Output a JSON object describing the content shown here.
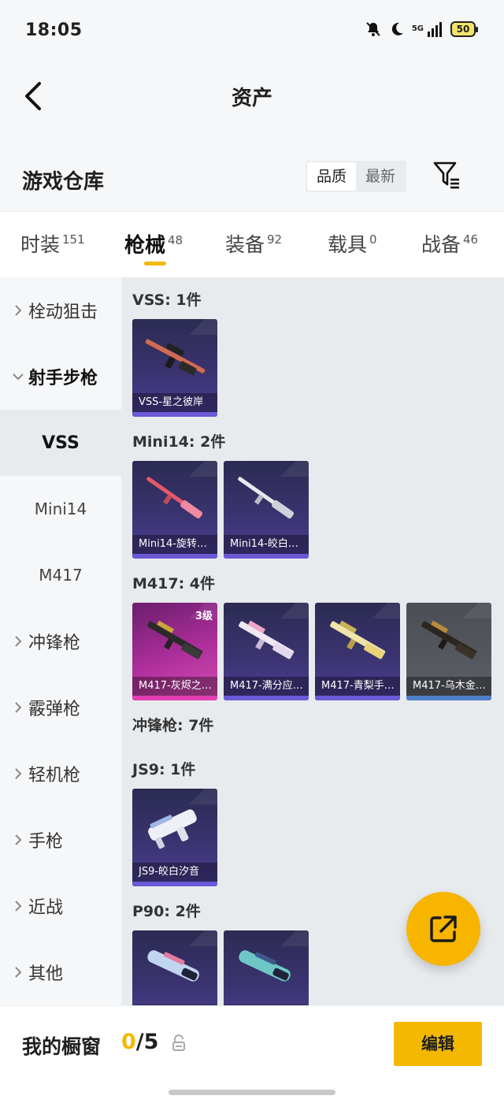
{
  "status_bar": {
    "time": "18:05",
    "network": "5G",
    "battery": "50"
  },
  "nav": {
    "title": "资产"
  },
  "warehouse": {
    "title": "游戏仓库",
    "sort_options": [
      "品质",
      "最新"
    ],
    "sort_selected": "品质"
  },
  "tabs": [
    {
      "label": "时装",
      "count": "151",
      "active": false
    },
    {
      "label": "枪械",
      "count": "48",
      "active": true
    },
    {
      "label": "装备",
      "count": "92",
      "active": false
    },
    {
      "label": "载具",
      "count": "0",
      "active": false
    },
    {
      "label": "战备",
      "count": "46",
      "active": false
    }
  ],
  "sidebar": {
    "categories": [
      {
        "label": "栓动狙击",
        "expanded": false
      },
      {
        "label": "射手步枪",
        "expanded": true
      },
      {
        "label": "冲锋枪",
        "expanded": false
      },
      {
        "label": "霰弹枪",
        "expanded": false
      },
      {
        "label": "轻机枪",
        "expanded": false
      },
      {
        "label": "手枪",
        "expanded": false
      },
      {
        "label": "近战",
        "expanded": false
      },
      {
        "label": "其他",
        "expanded": false
      }
    ],
    "subitems": [
      {
        "label": "VSS",
        "selected": true
      },
      {
        "label": "Mini14",
        "selected": false
      },
      {
        "label": "M417",
        "selected": false
      }
    ]
  },
  "groups": [
    {
      "title": "VSS: 1件",
      "items": [
        {
          "label": "VSS-星之彼岸",
          "rarity": "epic"
        }
      ]
    },
    {
      "title": "Mini14: 2件",
      "items": [
        {
          "label": "Mini14-旋转…",
          "rarity": "epic"
        },
        {
          "label": "Mini14-皎白…",
          "rarity": "epic"
        }
      ]
    },
    {
      "title": "M417: 4件",
      "items": [
        {
          "label": "M417-灰烬之…",
          "rarity": "legendary",
          "level": "3级"
        },
        {
          "label": "M417-满分应…",
          "rarity": "epic"
        },
        {
          "label": "M417-青梨手…",
          "rarity": "epic"
        },
        {
          "label": "M417-乌木金…",
          "rarity": "rare"
        }
      ]
    },
    {
      "title": "冲锋枪: 7件",
      "items": []
    },
    {
      "title": "JS9: 1件",
      "items": [
        {
          "label": "JS9-皎白汐音",
          "rarity": "epic"
        }
      ]
    },
    {
      "title": "P90: 2件",
      "items": [
        {
          "label": "",
          "rarity": "epic"
        },
        {
          "label": "",
          "rarity": "epic"
        }
      ]
    }
  ],
  "bottom": {
    "showcase_label": "我的橱窗",
    "showcase_current": "0",
    "showcase_total": "/5",
    "edit_label": "编辑"
  },
  "colors": {
    "accent": "#f5b800",
    "epic": "#6b59d6",
    "legendary": "#e23fb1",
    "rare": "#4f7fc9"
  }
}
